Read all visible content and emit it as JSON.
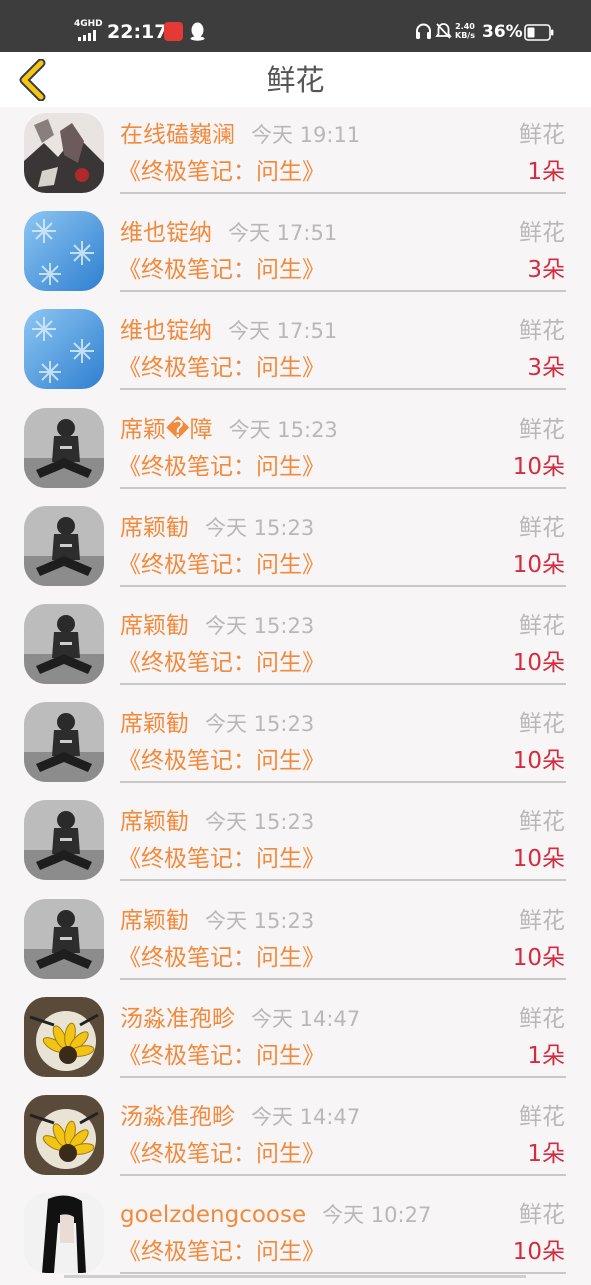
{
  "status_bar": {
    "network": "4GHD",
    "time": "22:17",
    "speed_value": "2.40",
    "speed_unit": "KB/s",
    "battery": "36%"
  },
  "nav": {
    "back_icon": "chevron-left-icon",
    "title": "鲜花"
  },
  "colors": {
    "accent": "#f28a3c",
    "count": "#d42c3e",
    "muted": "#b8b8b8",
    "back": "#f5c518"
  },
  "rows": [
    {
      "user": "在线磕巍澜",
      "time": "今天 19:11",
      "book": "《终极笔记：问生》",
      "gift": "鲜花",
      "count": "1朵",
      "avatar": "anime"
    },
    {
      "user": "维也锭纳",
      "time": "今天 17:51",
      "book": "《终极笔记：问生》",
      "gift": "鲜花",
      "count": "3朵",
      "avatar": "snow"
    },
    {
      "user": "维也锭纳",
      "time": "今天 17:51",
      "book": "《终极笔记：问生》",
      "gift": "鲜花",
      "count": "3朵",
      "avatar": "snow"
    },
    {
      "user": "席颖�障",
      "time": "今天 15:23",
      "book": "《终极笔记：问生》",
      "gift": "鲜花",
      "count": "10朵",
      "avatar": "girl"
    },
    {
      "user": "席颖勧",
      "time": "今天 15:23",
      "book": "《终极笔记：问生》",
      "gift": "鲜花",
      "count": "10朵",
      "avatar": "girl"
    },
    {
      "user": "席颖勧",
      "time": "今天 15:23",
      "book": "《终极笔记：问生》",
      "gift": "鲜花",
      "count": "10朵",
      "avatar": "girl"
    },
    {
      "user": "席颖勧",
      "time": "今天 15:23",
      "book": "《终极笔记：问生》",
      "gift": "鲜花",
      "count": "10朵",
      "avatar": "girl"
    },
    {
      "user": "席颖勧",
      "time": "今天 15:23",
      "book": "《终极笔记：问生》",
      "gift": "鲜花",
      "count": "10朵",
      "avatar": "girl"
    },
    {
      "user": "席颖勧",
      "time": "今天 15:23",
      "book": "《终极笔记：问生》",
      "gift": "鲜花",
      "count": "10朵",
      "avatar": "girl"
    },
    {
      "user": "汤淼准孢畛",
      "time": "今天 14:47",
      "book": "《终极笔记：问生》",
      "gift": "鲜花",
      "count": "1朵",
      "avatar": "sunflower"
    },
    {
      "user": "汤淼准孢畛",
      "time": "今天 14:47",
      "book": "《终极笔记：问生》",
      "gift": "鲜花",
      "count": "1朵",
      "avatar": "sunflower"
    },
    {
      "user": "goelzdengcoose",
      "time": "今天 10:27",
      "book": "《终极笔记：问生》",
      "gift": "鲜花",
      "count": "10朵",
      "avatar": "hair"
    }
  ]
}
